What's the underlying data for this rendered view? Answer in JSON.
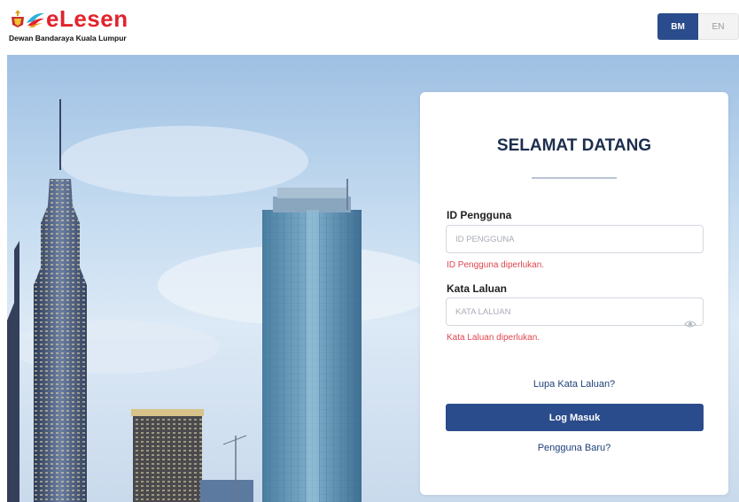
{
  "header": {
    "logo_text": "eLesen",
    "logo_subtitle": "Dewan Bandaraya Kuala Lumpur",
    "languages": [
      {
        "label": "BM",
        "active": true
      },
      {
        "label": "EN",
        "active": false
      }
    ]
  },
  "login": {
    "title": "SELAMAT DATANG",
    "username": {
      "label": "ID Pengguna",
      "placeholder": "ID PENGGUNA",
      "value": "",
      "error": "ID Pengguna diperlukan."
    },
    "password": {
      "label": "Kata Laluan",
      "placeholder": "KATA LALUAN",
      "value": "",
      "error": "Kata Laluan diperlukan.",
      "toggle_icon": "eye-icon"
    },
    "forgot_link": "Lupa Kata Laluan?",
    "submit_label": "Log Masuk",
    "register_link": "Pengguna Baru?"
  },
  "colors": {
    "brand_red": "#e2232e",
    "primary_blue": "#2b4c8c",
    "error_red": "#e0454f",
    "title_navy": "#1c2e4e"
  }
}
